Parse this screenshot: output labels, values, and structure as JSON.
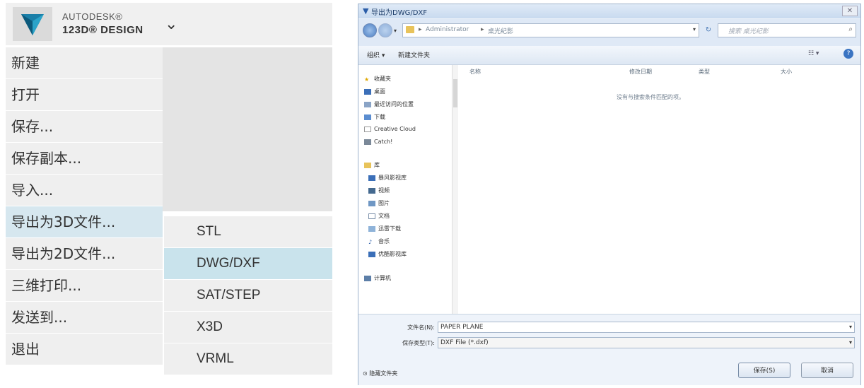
{
  "app_menu": {
    "brand_line1": "AUTODESK®",
    "brand_line2": "123D® DESIGN",
    "items": [
      {
        "label": "新建"
      },
      {
        "label": "打开"
      },
      {
        "label": "保存..."
      },
      {
        "label": "保存副本..."
      },
      {
        "label": "导入..."
      },
      {
        "label": "导出为3D文件..."
      },
      {
        "label": "导出为2D文件..."
      },
      {
        "label": "三维打印..."
      },
      {
        "label": "发送到..."
      },
      {
        "label": "退出"
      }
    ],
    "submenu": [
      {
        "label": "STL"
      },
      {
        "label": "DWG/DXF"
      },
      {
        "label": "SAT/STEP"
      },
      {
        "label": "X3D"
      },
      {
        "label": "VRML"
      }
    ]
  },
  "dialog": {
    "title": "导出为DWG/DXF",
    "address": {
      "crumb1": "Administrator",
      "crumb2": "桌光纪影"
    },
    "search": {
      "placeholder": "搜索 桌光纪影"
    },
    "toolbar": {
      "organize": "组织 ▾",
      "new_folder": "新建文件夹"
    },
    "nav_tree": [
      {
        "label": "收藏夹",
        "icon": "star-icon"
      },
      {
        "label": "桌面",
        "icon": "desktop-icon"
      },
      {
        "label": "最近访问的位置",
        "icon": "recent-places-icon"
      },
      {
        "label": "下载",
        "icon": "downloads-icon"
      },
      {
        "label": "Creative Cloud",
        "icon": "cloud-folder-icon"
      },
      {
        "label": "Catch!",
        "icon": "catch-icon"
      },
      {
        "label": "库",
        "icon": "libraries-icon"
      },
      {
        "label": "暴风影视库",
        "icon": "video-library-icon"
      },
      {
        "label": "视频",
        "icon": "videos-icon"
      },
      {
        "label": "图片",
        "icon": "pictures-icon"
      },
      {
        "label": "文档",
        "icon": "documents-icon"
      },
      {
        "label": "迅雷下载",
        "icon": "thunder-download-icon"
      },
      {
        "label": "音乐",
        "icon": "music-icon"
      },
      {
        "label": "优酷影视库",
        "icon": "youku-library-icon"
      },
      {
        "label": "计算机",
        "icon": "computer-icon"
      }
    ],
    "columns": [
      "名称",
      "修改日期",
      "类型",
      "大小"
    ],
    "empty_message": "没有与搜索条件匹配的项。",
    "filename_label": "文件名(N):",
    "filename_value": "PAPER PLANE",
    "filetype_label": "保存类型(T):",
    "filetype_value": "DXF File (*.dxf)",
    "hide_folders": "隐藏文件夹",
    "save_label": "保存(S)",
    "cancel_label": "取消"
  },
  "colors": {
    "menu_bg": "#efefef",
    "menu_hover": "#d6e7ef",
    "submenu_selected": "#c9e3ec",
    "dialog_bg": "#eef3fa"
  }
}
